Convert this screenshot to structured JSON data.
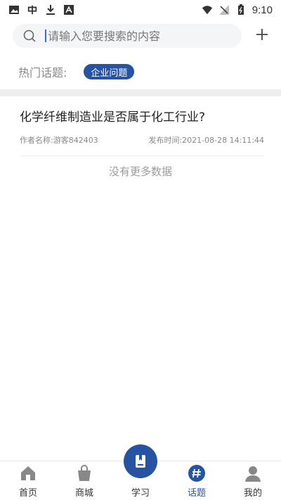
{
  "status_bar": {
    "time": "9:10",
    "icons": [
      "image-icon",
      "app-icon",
      "download-icon",
      "text-icon",
      "wifi-icon",
      "signal-icon",
      "battery-icon"
    ]
  },
  "search": {
    "placeholder": "请输入您要搜索的内容"
  },
  "hot_topics": {
    "label": "热门话题:",
    "tags": [
      "企业问题"
    ]
  },
  "posts": [
    {
      "title": "化学纤维制造业是否属于化工行业?",
      "author": "作者名称:游客842403",
      "time": "发布时间:2021-08-28 14:11:44"
    }
  ],
  "no_more": "没有更多数据",
  "nav": {
    "items": [
      {
        "label": "首页",
        "icon": "home-icon"
      },
      {
        "label": "商城",
        "icon": "shopping-bag-icon"
      },
      {
        "label": "学习",
        "icon": "book-icon"
      },
      {
        "label": "话题",
        "icon": "hashtag-icon"
      },
      {
        "label": "我的",
        "icon": "user-icon"
      }
    ],
    "active_index": 3
  },
  "colors": {
    "accent": "#2753a3",
    "muted": "#888888"
  }
}
